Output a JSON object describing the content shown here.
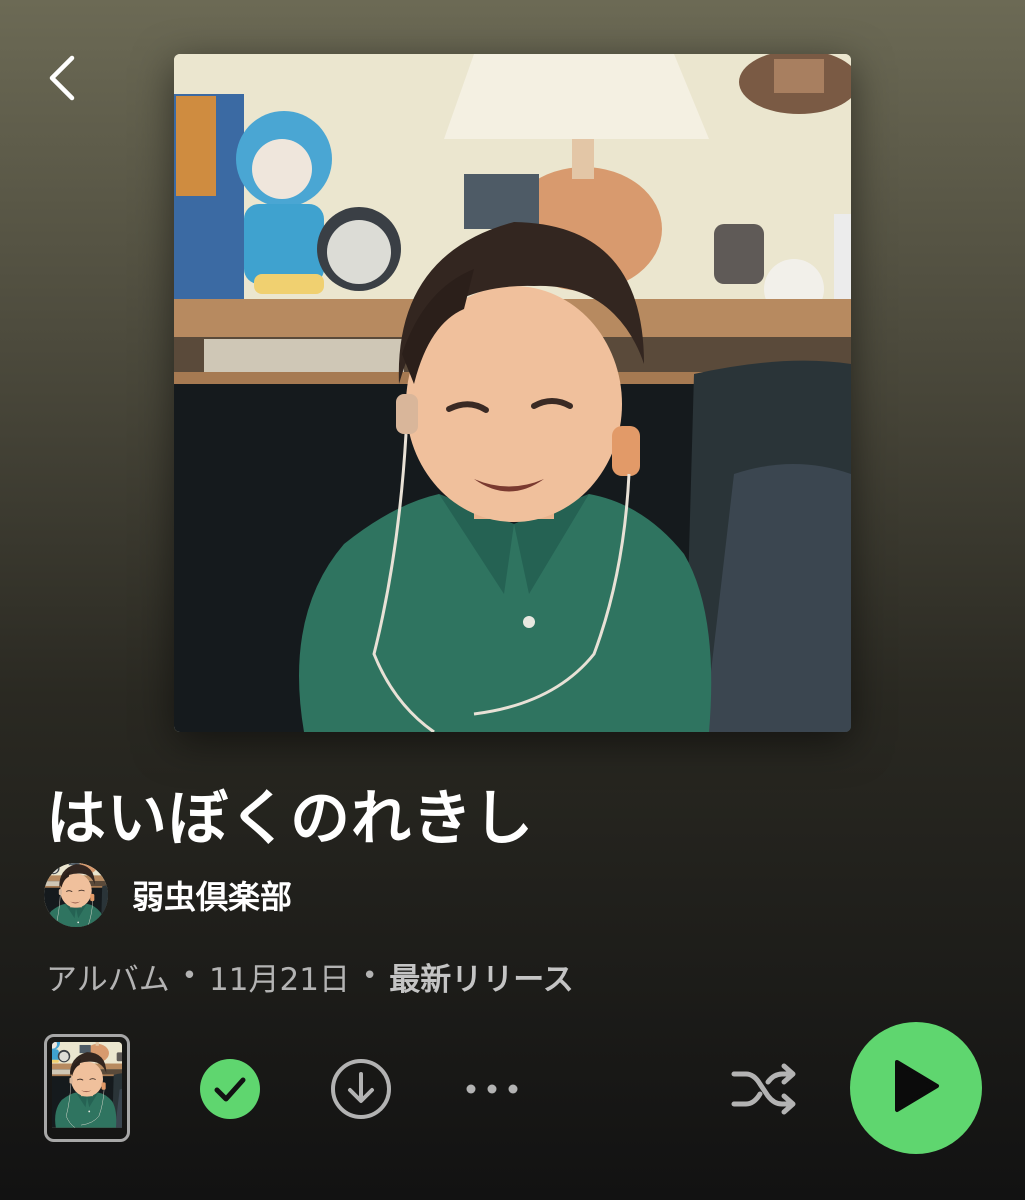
{
  "header": {
    "back_icon": "chevron-left-icon"
  },
  "album": {
    "title": "はいぼくのれきし",
    "type": "アルバム",
    "release_date": "11月21日",
    "release_tag": "最新リリース",
    "separator": "•",
    "cover_description_icon": "album-cover-image"
  },
  "artist": {
    "name": "弱虫倶楽部",
    "avatar_icon": "artist-avatar-image"
  },
  "controls": {
    "cover_thumb_icon": "canvas-preview-image",
    "saved_icon": "checkmark-circle-icon",
    "download_icon": "download-circle-icon",
    "more_icon": "more-horizontal-icon",
    "shuffle_icon": "shuffle-icon",
    "play_icon": "play-icon",
    "saved": true
  },
  "colors": {
    "accent_green": "#5fd66f",
    "background_top": "#6c6a55",
    "background_bottom": "#121212",
    "secondary_text": "#b3b3b3"
  }
}
